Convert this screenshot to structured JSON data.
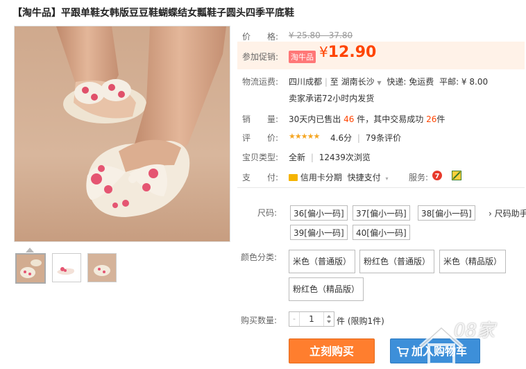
{
  "product": {
    "title": "【淘牛品】平跟单鞋女韩版豆豆鞋蝴蝶结女瓢鞋子圆头四季平底鞋"
  },
  "labels": {
    "price": "价　　格:",
    "promo": "参加促销:",
    "shipping": "物流运费:",
    "sales": "销　　量:",
    "rating": "评　　价:",
    "type": "宝贝类型:",
    "payment": "支　　付:",
    "size": "尺码:",
    "color": "颜色分类:",
    "qty": "购买数量:"
  },
  "price": {
    "original": "¥ 25.80 - 37.80",
    "promo_tag": "淘牛品",
    "currency": "¥",
    "promo": "12.90"
  },
  "shipping": {
    "from": "四川成都",
    "to_prefix": "至",
    "to": "湖南长沙",
    "express": "快递: 免运费",
    "surface": "平邮: ¥ 8.00",
    "promise": "卖家承诺72小时内发货"
  },
  "sales": {
    "prefix": "30天内已售出",
    "sold": "46",
    "mid": "件，其中交易成功",
    "success": "26",
    "suffix": "件"
  },
  "rating": {
    "stars": "★★★★★",
    "score": "4.6分",
    "divider": "|",
    "reviews": "79条评价",
    "score_value": 4.6
  },
  "item_type": {
    "condition": "全新",
    "divider": "|",
    "views": "12439次浏览"
  },
  "payment": {
    "installment": "信用卡分期",
    "quick": "快捷支付",
    "service_label": "服务:"
  },
  "sizes": [
    "36[偏小一码]",
    "37[偏小一码]",
    "38[偏小一码]",
    "39[偏小一码]",
    "40[偏小一码]"
  ],
  "size_helper": "尺码助手",
  "colors": [
    "米色（普通版）",
    "粉红色（普通版）",
    "米色（精品版）",
    "粉红色（精品版）"
  ],
  "quantity": {
    "value": "1",
    "minus": "-",
    "unit_note": "件 (限购1件)"
  },
  "buttons": {
    "buy_now": "立刻购买",
    "add_cart": "加入购物车"
  },
  "watermark": "08家",
  "colors_theme": {
    "accent": "#ff4400",
    "buy": "#ff7e2e",
    "cart": "#3d8fd9"
  }
}
